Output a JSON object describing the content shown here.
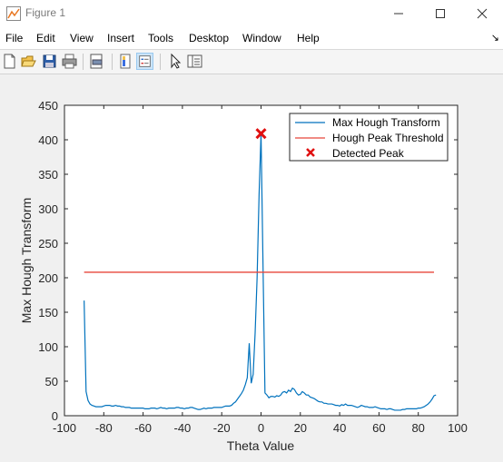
{
  "window": {
    "title": "Figure 1"
  },
  "menu": [
    "File",
    "Edit",
    "View",
    "Insert",
    "Tools",
    "Desktop",
    "Window",
    "Help"
  ],
  "toolbar": [
    "new-figure-icon",
    "open-file-icon",
    "save-icon",
    "print-icon",
    "print-preview-icon",
    "colorbar-icon",
    "legend-icon",
    "select-arrow-icon",
    "property-inspector-icon"
  ],
  "colors": {
    "line": "#0072bd",
    "threshold": "#e8463a",
    "peak": "#e01010"
  },
  "chart_data": {
    "type": "line",
    "xlabel": "Theta Value",
    "ylabel": "Max Hough Transform",
    "xlim": [
      -100,
      100
    ],
    "ylim": [
      0,
      450
    ],
    "xticks": [
      -100,
      -80,
      -60,
      -40,
      -20,
      0,
      20,
      40,
      60,
      80,
      100
    ],
    "yticks": [
      0,
      50,
      100,
      150,
      200,
      250,
      300,
      350,
      400,
      450
    ],
    "legend_position": "top-right",
    "series": [
      {
        "name": "Max Hough Transform",
        "type": "line",
        "x": [
          -90,
          -89,
          -88,
          -87,
          -86,
          -85,
          -84,
          -83,
          -82,
          -81,
          -80,
          -79,
          -78,
          -77,
          -76,
          -75,
          -74,
          -73,
          -72,
          -71,
          -70,
          -69,
          -68,
          -67,
          -66,
          -65,
          -64,
          -63,
          -62,
          -61,
          -60,
          -59,
          -58,
          -57,
          -56,
          -55,
          -54,
          -53,
          -52,
          -51,
          -50,
          -49,
          -48,
          -47,
          -46,
          -45,
          -44,
          -43,
          -42,
          -41,
          -40,
          -39,
          -38,
          -37,
          -36,
          -35,
          -34,
          -33,
          -32,
          -31,
          -30,
          -29,
          -28,
          -27,
          -26,
          -25,
          -24,
          -23,
          -22,
          -21,
          -20,
          -19,
          -18,
          -17,
          -16,
          -15,
          -14,
          -13,
          -12,
          -11,
          -10,
          -9,
          -8,
          -7,
          -6,
          -5,
          -4,
          -3,
          -2,
          -1,
          0,
          1,
          2,
          3,
          4,
          5,
          6,
          7,
          8,
          9,
          10,
          11,
          12,
          13,
          14,
          15,
          16,
          17,
          18,
          19,
          20,
          21,
          22,
          23,
          24,
          25,
          26,
          27,
          28,
          29,
          30,
          31,
          32,
          33,
          34,
          35,
          36,
          37,
          38,
          39,
          40,
          41,
          42,
          43,
          44,
          45,
          46,
          47,
          48,
          49,
          50,
          51,
          52,
          53,
          54,
          55,
          56,
          57,
          58,
          59,
          60,
          61,
          62,
          63,
          64,
          65,
          66,
          67,
          68,
          69,
          70,
          71,
          72,
          73,
          74,
          75,
          76,
          77,
          78,
          79,
          80,
          81,
          82,
          83,
          84,
          85,
          86,
          87,
          88,
          89
        ],
        "y": [
          167,
          35,
          22,
          17,
          15,
          14,
          13,
          13,
          13,
          13,
          14,
          15,
          15,
          15,
          14,
          14,
          15,
          14,
          14,
          13,
          13,
          12,
          12,
          12,
          11,
          11,
          11,
          11,
          11,
          11,
          11,
          10,
          10,
          10,
          11,
          11,
          11,
          10,
          11,
          12,
          11,
          11,
          10,
          11,
          11,
          11,
          11,
          12,
          12,
          11,
          11,
          10,
          11,
          11,
          12,
          12,
          11,
          10,
          9,
          9,
          10,
          11,
          10,
          11,
          11,
          11,
          12,
          12,
          12,
          12,
          12,
          13,
          14,
          14,
          14,
          15,
          18,
          20,
          24,
          28,
          32,
          37,
          45,
          55,
          105,
          47,
          60,
          120,
          200,
          320,
          409,
          220,
          33,
          30,
          26,
          28,
          28,
          27,
          29,
          28,
          30,
          34,
          35,
          33,
          37,
          35,
          40,
          38,
          33,
          30,
          31,
          35,
          33,
          30,
          30,
          27,
          26,
          25,
          23,
          21,
          20,
          20,
          18,
          18,
          17,
          17,
          17,
          16,
          15,
          15,
          14,
          16,
          15,
          17,
          15,
          15,
          15,
          14,
          13,
          12,
          13,
          15,
          14,
          13,
          13,
          12,
          12,
          12,
          13,
          12,
          11,
          10,
          10,
          10,
          9,
          10,
          10,
          9,
          8,
          8,
          8,
          8,
          9,
          9,
          10,
          10,
          10,
          10,
          10,
          10,
          11,
          11,
          12,
          13,
          15,
          17,
          20,
          24,
          29,
          30
        ]
      },
      {
        "name": "Hough Peak Threshold",
        "type": "line",
        "x": [
          -90,
          88
        ],
        "y": [
          208,
          208
        ]
      },
      {
        "name": "Detected Peak",
        "type": "marker",
        "x": [
          0
        ],
        "y": [
          409
        ]
      }
    ]
  }
}
